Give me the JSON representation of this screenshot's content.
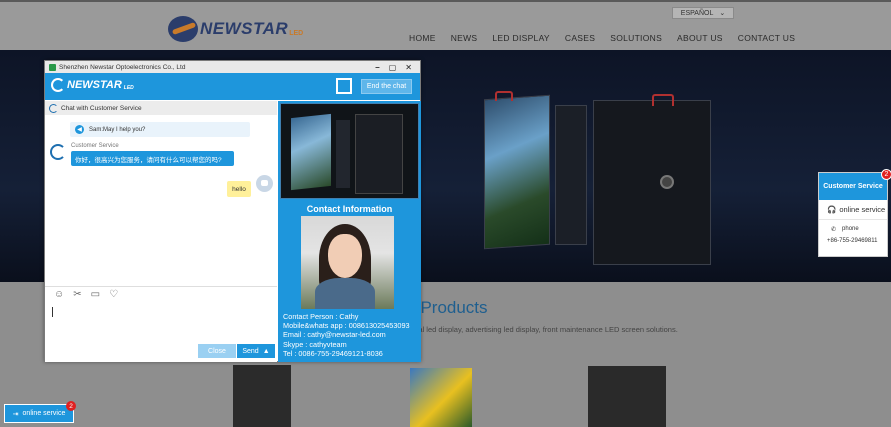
{
  "header": {
    "logo_text": "NEWSTAR",
    "logo_suffix": "LED",
    "language": "ESPAÑOL",
    "nav": [
      "HOME",
      "NEWS",
      "LED DISPLAY",
      "CASES",
      "SOLUTIONS",
      "ABOUT US",
      "CONTACT US"
    ]
  },
  "products": {
    "title": "t Products",
    "subtitle": "ssional rental led display, advertising led display, front maintenance LED screen solutions."
  },
  "chat": {
    "window_title": "Shenzhen Newstar Optoelectronics Co., Ltd",
    "logo_text": "NEWSTAR",
    "logo_suffix": "LED",
    "end_chat": "End the chat",
    "pane_label": "Chat with Customer Service",
    "help_text": "Sam:May I help you?",
    "agent_name": "Customer Service",
    "agent_message": "你好，很高兴为您服务，请问有什么可以帮您的吗?",
    "user_message": "hello",
    "close_label": "Close",
    "send_label": "Send",
    "send_arrow": "▲",
    "contact_title": "Contact Information",
    "contact_lines": [
      "Contact Person : Cathy",
      "Mobile&whats app : 008613025453093",
      "Email : cathy@newstar-led.com",
      "Skype : cathyvteam",
      "Tel : 0086-755-29469121-8036"
    ]
  },
  "cs_widget": {
    "title": "Customer Service",
    "badge": "2",
    "online": "online service",
    "phone_label": "phone",
    "phone_number": "+86-755-29469811"
  },
  "online_button": {
    "label": "online service",
    "badge": "2"
  }
}
